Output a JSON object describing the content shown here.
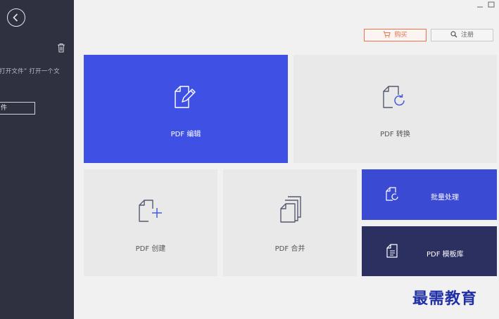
{
  "sidebar": {
    "hint_text": "打开文件” 打开一个文",
    "open_button_label": "件"
  },
  "topbar": {
    "buy_label": "购买",
    "register_label": "注册"
  },
  "tiles": {
    "edit": {
      "label": "PDF 编辑",
      "icon": "edit-document-icon"
    },
    "convert": {
      "label": "PDF 转换",
      "icon": "convert-document-icon"
    },
    "create": {
      "label": "PDF 创建",
      "icon": "create-document-icon"
    },
    "merge": {
      "label": "PDF 合并",
      "icon": "merge-documents-icon"
    },
    "batch": {
      "label": "批量处理",
      "icon": "batch-process-icon"
    },
    "templates": {
      "label": "PDF 模板库",
      "icon": "template-library-icon"
    }
  },
  "watermark": "最需教育",
  "colors": {
    "sidebar": "#2f3040",
    "edit_tile": "#3f51e5",
    "batch_tile": "#3a4ad3",
    "template_tile": "#2c3060",
    "buy_accent": "#e8734d"
  }
}
